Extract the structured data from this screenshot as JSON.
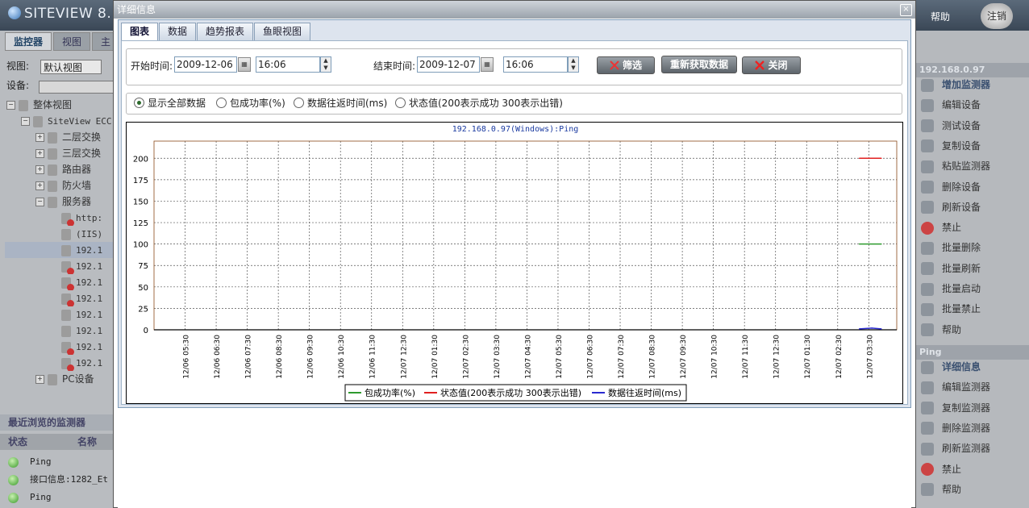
{
  "app": {
    "logo": "SITEVIEW 8.1",
    "header_help": "帮助",
    "header_logout": "注销"
  },
  "left": {
    "tabs": [
      "监控器",
      "视图",
      "主"
    ],
    "view_label": "视图:",
    "view_value": "默认视图",
    "device_label": "设备:",
    "tree": [
      {
        "label": "整体视图",
        "indent": 0
      },
      {
        "label": "SiteView ECC",
        "indent": 1
      },
      {
        "label": "二层交换",
        "indent": 2
      },
      {
        "label": "三层交换",
        "indent": 2
      },
      {
        "label": "路由器",
        "indent": 2
      },
      {
        "label": "防火墙",
        "indent": 2
      },
      {
        "label": "服务器",
        "indent": 2
      },
      {
        "label": "http:",
        "indent": 3
      },
      {
        "label": "(IIS)",
        "indent": 3
      },
      {
        "label": "192.1",
        "indent": 3
      },
      {
        "label": "192.1",
        "indent": 3
      },
      {
        "label": "192.1",
        "indent": 3
      },
      {
        "label": "192.1",
        "indent": 3
      },
      {
        "label": "192.1",
        "indent": 3
      },
      {
        "label": "192.1",
        "indent": 3
      },
      {
        "label": "192.1",
        "indent": 3
      },
      {
        "label": "192.1",
        "indent": 3
      },
      {
        "label": "PC设备",
        "indent": 2
      }
    ],
    "recent_title": "最近浏览的监测器",
    "recent_head_status": "状态",
    "recent_head_name": "名称",
    "recent": [
      "Ping",
      "接口信息:1282_Et",
      "Ping"
    ]
  },
  "right": {
    "section1_title": "192.168.0.97",
    "section1_items": [
      "增加监测器",
      "编辑设备",
      "测试设备",
      "复制设备",
      "粘贴监测器",
      "删除设备",
      "刷新设备",
      "禁止",
      "批量删除",
      "批量刷新",
      "批量启动",
      "批量禁止",
      "帮助"
    ],
    "section2_title": "Ping",
    "section2_items": [
      "详细信息",
      "编辑监测器",
      "复制监测器",
      "删除监测器",
      "刷新监测器",
      "禁止",
      "帮助"
    ]
  },
  "dialog": {
    "title": "详细信息",
    "close": "×",
    "tabs": [
      "图表",
      "数据",
      "趋势报表",
      "鱼眼视图"
    ],
    "active_tab": 0,
    "start_label": "开始时间:",
    "start_date": "2009-12-06",
    "start_time": "16:06",
    "end_label": "结束时间:",
    "end_date": "2009-12-07",
    "end_time": "16:06",
    "btn_filter": "筛选",
    "btn_refresh": "重新获取数据",
    "btn_close": "关闭",
    "radios": [
      "显示全部数据",
      "包成功率(%)",
      "数据往返时间(ms)",
      "状态值(200表示成功 300表示出错)"
    ],
    "radio_selected": 0
  },
  "chart_data": {
    "type": "line",
    "title": "192.168.0.97(Windows):Ping",
    "ylim": [
      0,
      220
    ],
    "yticks": [
      0,
      25,
      50,
      75,
      100,
      125,
      150,
      175,
      200
    ],
    "x": [
      "12/06 05:30",
      "12/06 06:30",
      "12/06 07:30",
      "12/06 08:30",
      "12/06 09:30",
      "12/06 10:30",
      "12/06 11:30",
      "12/07 12:30",
      "12/07 01:30",
      "12/07 02:30",
      "12/07 03:30",
      "12/07 04:30",
      "12/07 05:30",
      "12/07 06:30",
      "12/07 07:30",
      "12/07 08:30",
      "12/07 09:30",
      "12/07 10:30",
      "12/07 11:30",
      "12/07 12:30",
      "12/07 01:30",
      "12/07 02:30",
      "12/07 03:30"
    ],
    "grid": true,
    "legend_position": "bottom",
    "series": [
      {
        "name": "包成功率(%)",
        "color": "#2e9a2e",
        "points": [
          [
            22.7,
            100
          ],
          [
            23.4,
            100
          ]
        ]
      },
      {
        "name": "状态值(200表示成功 300表示出错)",
        "color": "#e02020",
        "points": [
          [
            22.7,
            200
          ],
          [
            23.4,
            200
          ]
        ]
      },
      {
        "name": "数据往返时间(ms)",
        "color": "#2a2ad0",
        "points": [
          [
            22.7,
            1
          ],
          [
            23.1,
            2
          ],
          [
            23.4,
            1
          ]
        ]
      }
    ]
  },
  "colors": {
    "grid": "#555555",
    "plot_border": "#8b4a1a"
  }
}
